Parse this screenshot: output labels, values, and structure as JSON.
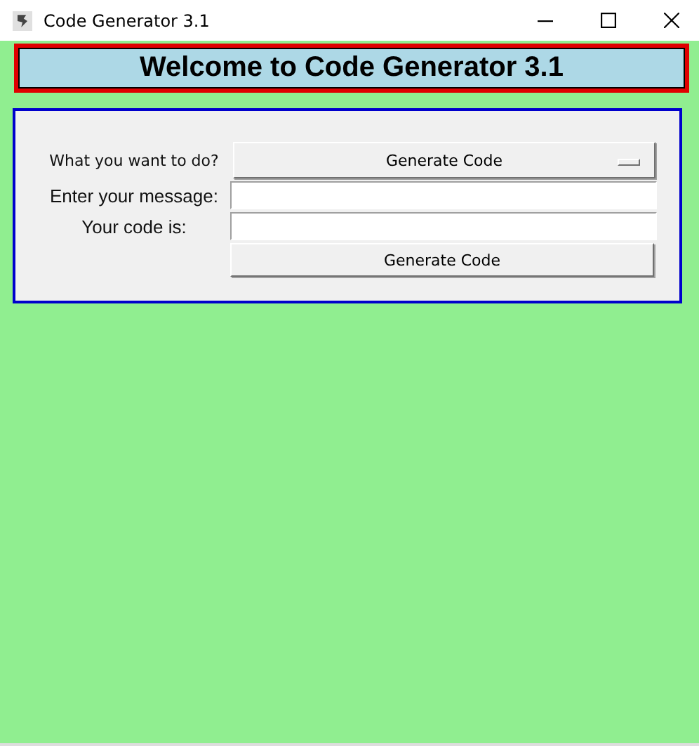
{
  "window": {
    "title": "Code Generator 3.1"
  },
  "header": {
    "title": "Welcome to Code Generator 3.1"
  },
  "form": {
    "action_label": "What you want to do?",
    "action_value": "Generate Code",
    "message_label": "Enter your message:",
    "code_label": "Your code is:",
    "button": "Generate Code"
  }
}
